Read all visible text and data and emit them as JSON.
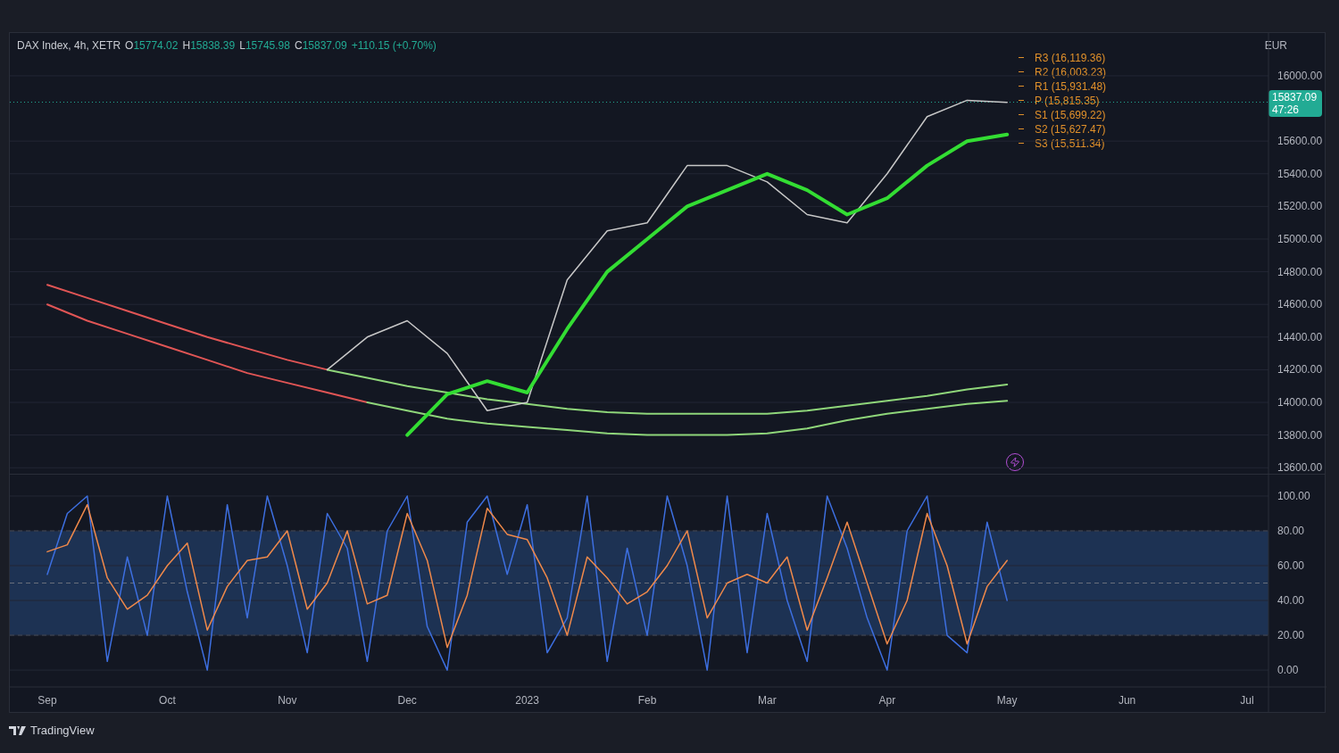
{
  "header": {
    "symbol": "DAX Index, 4h, XETR",
    "ohlc": [
      {
        "key": "O",
        "value": "15774.02"
      },
      {
        "key": "H",
        "value": "15838.39"
      },
      {
        "key": "L",
        "value": "15745.98"
      },
      {
        "key": "C",
        "value": "15837.09"
      }
    ],
    "change": "+110.15 (+0.70%)"
  },
  "price_pane": {
    "currency": "EUR",
    "last_price": {
      "price": "15837.09",
      "countdown": "47:26"
    },
    "pivots": [
      "R3 (16,119.36)",
      "R2 (16,003.23)",
      "R1 (15,931.48)",
      "P (15,815.35)",
      "S1 (15,699.22)",
      "S2 (15,627.47)",
      "S3 (15,511.34)"
    ],
    "chart_data": {
      "type": "line",
      "grid": true,
      "categories": [
        null,
        null,
        null,
        null,
        null,
        null,
        null,
        null,
        null,
        null,
        null,
        null,
        null,
        null,
        null,
        null,
        null,
        null,
        null,
        null,
        null,
        null,
        null,
        null,
        null,
        null,
        null,
        null,
        null,
        null,
        null
      ],
      "ylim": [
        13563,
        16262
      ],
      "yticks": [
        {
          "value": 13600,
          "label": "13600.00"
        },
        {
          "value": 13800,
          "label": "13800.00"
        },
        {
          "value": 14000,
          "label": "14000.00"
        },
        {
          "value": 14200,
          "label": "14200.00"
        },
        {
          "value": 14400,
          "label": "14400.00"
        },
        {
          "value": 14600,
          "label": "14600.00"
        },
        {
          "value": 14800,
          "label": "14800.00"
        },
        {
          "value": 15000,
          "label": "15000.00"
        },
        {
          "value": 15200,
          "label": "15200.00"
        },
        {
          "value": 15400,
          "label": "15400.00"
        },
        {
          "value": 15600,
          "label": "15600.00"
        },
        {
          "value": 16000,
          "label": "16000.00"
        }
      ],
      "series": [
        {
          "color": "#e05555",
          "values": [
            14720,
            14640,
            14560,
            14480,
            14400,
            14330,
            14260,
            14200,
            null,
            null,
            null,
            null,
            null,
            null,
            null,
            null,
            null,
            null,
            null,
            null,
            null,
            null,
            null,
            null,
            null,
            null,
            null,
            null,
            null,
            null,
            null
          ]
        },
        {
          "color": "#e05555",
          "values": [
            14600,
            14500,
            14420,
            14340,
            14260,
            14180,
            14120,
            14060,
            14000,
            null,
            null,
            null,
            null,
            null,
            null,
            null,
            null,
            null,
            null,
            null,
            null,
            null,
            null,
            null,
            null,
            null,
            null,
            null,
            null,
            null,
            null
          ]
        },
        {
          "color": "#8fd67a",
          "values": [
            null,
            null,
            null,
            null,
            null,
            null,
            null,
            14200,
            14150,
            14100,
            14060,
            14020,
            13990,
            13960,
            13940,
            13930,
            13930,
            13930,
            13930,
            13950,
            13980,
            14010,
            14040,
            14080,
            14110,
            null,
            null,
            null,
            null,
            null,
            null
          ]
        },
        {
          "color": "#8fd67a",
          "values": [
            null,
            null,
            null,
            null,
            null,
            null,
            null,
            null,
            14000,
            13950,
            13900,
            13870,
            13850,
            13830,
            13810,
            13800,
            13800,
            13800,
            13810,
            13840,
            13890,
            13930,
            13960,
            13990,
            14010,
            null,
            null,
            null,
            null,
            null,
            null
          ]
        },
        {
          "color": "#c8c8c8",
          "values": [
            null,
            null,
            null,
            null,
            null,
            null,
            null,
            14200,
            14400,
            14500,
            14300,
            13950,
            14000,
            14750,
            15050,
            15100,
            15450,
            15450,
            15350,
            15150,
            15100,
            15400,
            15750,
            15850,
            15837,
            null,
            null,
            null,
            null,
            null,
            null
          ]
        },
        {
          "color": "#33dd33",
          "values": [
            null,
            null,
            null,
            null,
            null,
            null,
            null,
            null,
            null,
            13800,
            14050,
            14130,
            14060,
            14450,
            14800,
            15000,
            15200,
            15300,
            15400,
            15300,
            15150,
            15250,
            15450,
            15600,
            15640,
            null,
            null,
            null,
            null,
            null,
            null
          ]
        }
      ]
    }
  },
  "oscillator_pane": {
    "chart_data": {
      "type": "line",
      "categories": [
        "Sep",
        null,
        null,
        null,
        null,
        null,
        "Oct",
        null,
        null,
        null,
        null,
        null,
        "Nov",
        null,
        null,
        null,
        null,
        null,
        "Dec",
        null,
        null,
        null,
        null,
        null,
        "2023",
        null,
        null,
        null,
        null,
        null,
        "Feb",
        null,
        null,
        null,
        null,
        null,
        "Mar",
        null,
        null,
        null,
        null,
        null,
        "Apr",
        null,
        null,
        null,
        null,
        null,
        "May",
        null,
        null,
        null,
        null,
        null,
        "Jun",
        null,
        null,
        null,
        null,
        null,
        "Jul"
      ],
      "ylim": [
        -9.7,
        112.3
      ],
      "yticks": [
        {
          "value": 0,
          "label": "0.00"
        },
        {
          "value": 20,
          "label": "20.00"
        },
        {
          "value": 40,
          "label": "40.00"
        },
        {
          "value": 60,
          "label": "60.00"
        },
        {
          "value": 80,
          "label": "80.00"
        },
        {
          "value": 100,
          "label": "100.00"
        }
      ],
      "grid": true,
      "series": [
        {
          "color": "#3d6fe0",
          "values": [
            55,
            90,
            100,
            5,
            65,
            20,
            100,
            45,
            0,
            95,
            30,
            100,
            60,
            10,
            90,
            70,
            5,
            80,
            100,
            25,
            0,
            85,
            100,
            55,
            95,
            10,
            30,
            100,
            5,
            70,
            20,
            100,
            60,
            0,
            100,
            10,
            90,
            40,
            5,
            100,
            70,
            30,
            0,
            80,
            100,
            20,
            10,
            85,
            40,
            null,
            null,
            null,
            null,
            null,
            null,
            null,
            null,
            null,
            null,
            null,
            null
          ]
        },
        {
          "color": "#f0894a",
          "values": [
            68,
            72,
            95,
            53,
            35,
            43,
            60,
            73,
            23,
            48,
            63,
            65,
            80,
            35,
            50,
            80,
            38,
            43,
            90,
            63,
            13,
            43,
            93,
            78,
            75,
            53,
            20,
            65,
            53,
            38,
            45,
            60,
            80,
            30,
            50,
            55,
            50,
            65,
            23,
            53,
            85,
            50,
            15,
            40,
            90,
            60,
            15,
            48,
            63,
            null,
            null,
            null,
            null,
            null,
            null,
            null,
            null,
            null,
            null,
            null,
            null
          ]
        }
      ]
    }
  },
  "footer": {
    "brand": "TradingView"
  }
}
